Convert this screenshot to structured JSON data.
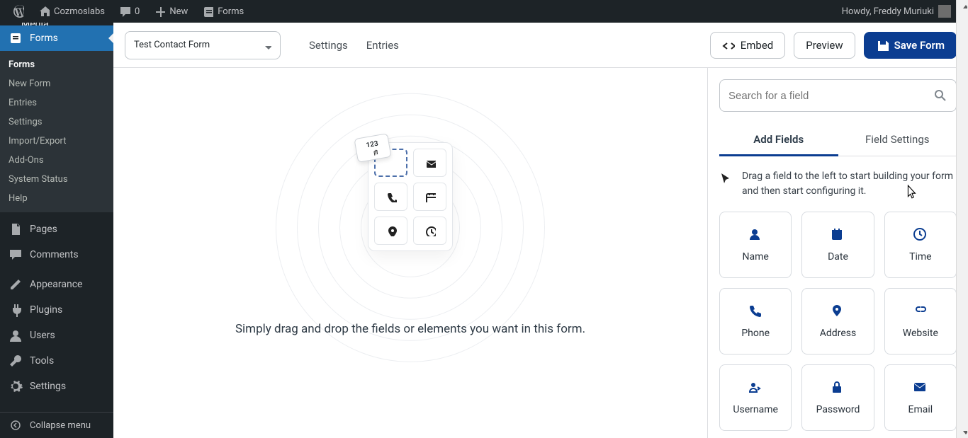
{
  "adminbar": {
    "site": "Cozmoslabs",
    "comments": "0",
    "new": "New",
    "forms": "Forms",
    "howdy": "Howdy, Freddy Muriuki"
  },
  "sidebar": {
    "media_partial": "Media",
    "active": "Forms",
    "submenu": [
      "Forms",
      "New Form",
      "Entries",
      "Settings",
      "Import/Export",
      "Add-Ons",
      "System Status",
      "Help"
    ],
    "items": [
      {
        "label": "Pages",
        "icon": "pages"
      },
      {
        "label": "Comments",
        "icon": "comments"
      },
      {
        "label": "Appearance",
        "icon": "appearance"
      },
      {
        "label": "Plugins",
        "icon": "plugins"
      },
      {
        "label": "Users",
        "icon": "users"
      },
      {
        "label": "Tools",
        "icon": "tools"
      },
      {
        "label": "Settings",
        "icon": "settings"
      }
    ],
    "collapse": "Collapse menu"
  },
  "toolbar": {
    "form_name": "Test Contact Form",
    "links": {
      "settings": "Settings",
      "entries": "Entries"
    },
    "embed": "Embed",
    "preview": "Preview",
    "save": "Save Form"
  },
  "canvas": {
    "drag_chip": "123",
    "text": "Simply drag and drop the fields or elements you want in this form."
  },
  "panel": {
    "search_placeholder": "Search for a field",
    "tabs": {
      "add": "Add Fields",
      "settings": "Field Settings"
    },
    "hint": "Drag a field to the left to start building your form and then start configuring it.",
    "fields": [
      {
        "label": "Name",
        "icon": "name"
      },
      {
        "label": "Date",
        "icon": "date"
      },
      {
        "label": "Time",
        "icon": "time"
      },
      {
        "label": "Phone",
        "icon": "phone"
      },
      {
        "label": "Address",
        "icon": "address"
      },
      {
        "label": "Website",
        "icon": "website"
      },
      {
        "label": "Username",
        "icon": "username"
      },
      {
        "label": "Password",
        "icon": "password"
      },
      {
        "label": "Email",
        "icon": "email"
      }
    ]
  }
}
